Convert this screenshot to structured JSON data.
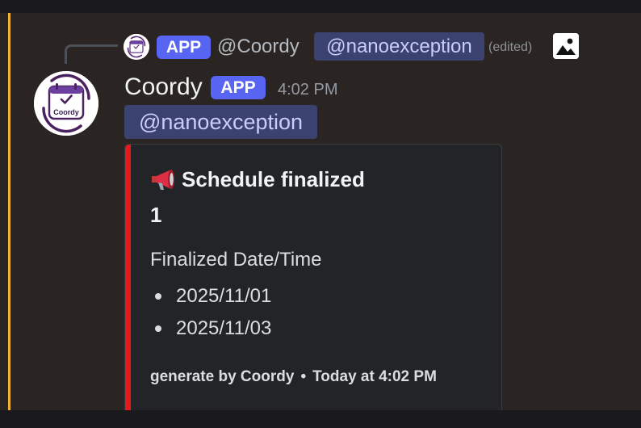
{
  "reply": {
    "badge": "APP",
    "author": "@Coordy",
    "mention": "@nanoexception",
    "edited": "(edited)",
    "attachment_icon": "image-icon"
  },
  "message": {
    "author": "Coordy",
    "badge": "APP",
    "timestamp": "4:02 PM",
    "mention": "@nanoexception",
    "avatar_label": "Coordy"
  },
  "embed": {
    "accent_color": "#e81919",
    "title_icon": "megaphone-icon",
    "title": "Schedule finalized",
    "description": "1",
    "field_name": "Finalized Date/Time",
    "field_values": [
      "2025/11/01",
      "2025/11/03"
    ],
    "footer_text": "generate by Coordy",
    "footer_separator": "•",
    "footer_time": "Today at 4:02 PM"
  },
  "colors": {
    "badge": "#5865f2",
    "mention_bg": "#3c4270",
    "highlight_bar": "#f0b232",
    "background": "#2a2522"
  }
}
